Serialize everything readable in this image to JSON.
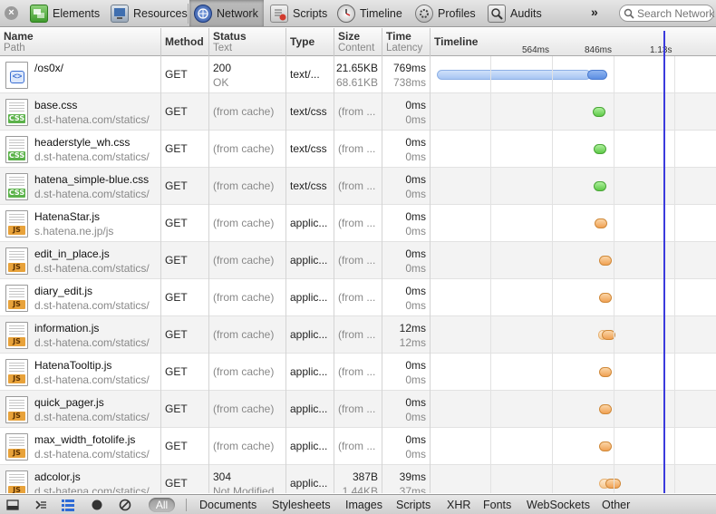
{
  "toolbar": {
    "close_glyph": "×",
    "tabs": [
      {
        "label": "Elements",
        "icon": "elements-icon",
        "active": false
      },
      {
        "label": "Resources",
        "icon": "resources-icon",
        "active": false
      },
      {
        "label": "Network",
        "icon": "network-icon",
        "active": true
      },
      {
        "label": "Scripts",
        "icon": "scripts-icon",
        "active": false
      },
      {
        "label": "Timeline",
        "icon": "timeline-icon",
        "active": false
      },
      {
        "label": "Profiles",
        "icon": "profiles-icon",
        "active": false
      },
      {
        "label": "Audits",
        "icon": "audits-icon",
        "active": false
      }
    ],
    "more_label": "»",
    "search_placeholder": "Search Network"
  },
  "columns": {
    "name": {
      "main": "Name",
      "sub": "Path"
    },
    "method": {
      "main": "Method"
    },
    "status": {
      "main": "Status",
      "sub": "Text"
    },
    "type": {
      "main": "Type"
    },
    "size": {
      "main": "Size",
      "sub": "Content"
    },
    "time": {
      "main": "Time",
      "sub": "Latency"
    },
    "timeline": {
      "main": "Timeline"
    }
  },
  "timeline_ticks": [
    "564ms",
    "846ms",
    "1.13s"
  ],
  "rows": [
    {
      "name": "/os0x/",
      "path": "",
      "kind": "doc",
      "method": "GET",
      "status": "200",
      "status_text": "OK",
      "type": "text/...",
      "size": "21.65KB",
      "content": "68.61KB",
      "time": "769ms",
      "latency": "738ms"
    },
    {
      "name": "base.css",
      "path": "d.st-hatena.com/statics/",
      "kind": "css",
      "method": "GET",
      "status": "(from cache)",
      "status_text": "",
      "type": "text/css",
      "size": "(from ...",
      "content": "",
      "time": "0ms",
      "latency": "0ms"
    },
    {
      "name": "headerstyle_wh.css",
      "path": "d.st-hatena.com/statics/",
      "kind": "css",
      "method": "GET",
      "status": "(from cache)",
      "status_text": "",
      "type": "text/css",
      "size": "(from ...",
      "content": "",
      "time": "0ms",
      "latency": "0ms"
    },
    {
      "name": "hatena_simple-blue.css",
      "path": "d.st-hatena.com/statics/",
      "kind": "css",
      "method": "GET",
      "status": "(from cache)",
      "status_text": "",
      "type": "text/css",
      "size": "(from ...",
      "content": "",
      "time": "0ms",
      "latency": "0ms"
    },
    {
      "name": "HatenaStar.js",
      "path": "s.hatena.ne.jp/js",
      "kind": "js",
      "method": "GET",
      "status": "(from cache)",
      "status_text": "",
      "type": "applic...",
      "size": "(from ...",
      "content": "",
      "time": "0ms",
      "latency": "0ms"
    },
    {
      "name": "edit_in_place.js",
      "path": "d.st-hatena.com/statics/",
      "kind": "js",
      "method": "GET",
      "status": "(from cache)",
      "status_text": "",
      "type": "applic...",
      "size": "(from ...",
      "content": "",
      "time": "0ms",
      "latency": "0ms"
    },
    {
      "name": "diary_edit.js",
      "path": "d.st-hatena.com/statics/",
      "kind": "js",
      "method": "GET",
      "status": "(from cache)",
      "status_text": "",
      "type": "applic...",
      "size": "(from ...",
      "content": "",
      "time": "0ms",
      "latency": "0ms"
    },
    {
      "name": "information.js",
      "path": "d.st-hatena.com/statics/",
      "kind": "js",
      "method": "GET",
      "status": "(from cache)",
      "status_text": "",
      "type": "applic...",
      "size": "(from ...",
      "content": "",
      "time": "12ms",
      "latency": "12ms"
    },
    {
      "name": "HatenaTooltip.js",
      "path": "d.st-hatena.com/statics/",
      "kind": "js",
      "method": "GET",
      "status": "(from cache)",
      "status_text": "",
      "type": "applic...",
      "size": "(from ...",
      "content": "",
      "time": "0ms",
      "latency": "0ms"
    },
    {
      "name": "quick_pager.js",
      "path": "d.st-hatena.com/statics/",
      "kind": "js",
      "method": "GET",
      "status": "(from cache)",
      "status_text": "",
      "type": "applic...",
      "size": "(from ...",
      "content": "",
      "time": "0ms",
      "latency": "0ms"
    },
    {
      "name": "max_width_fotolife.js",
      "path": "d.st-hatena.com/statics/",
      "kind": "js",
      "method": "GET",
      "status": "(from cache)",
      "status_text": "",
      "type": "applic...",
      "size": "(from ...",
      "content": "",
      "time": "0ms",
      "latency": "0ms"
    },
    {
      "name": "adcolor.js",
      "path": "d.st-hatena.com/statics/",
      "kind": "js",
      "method": "GET",
      "status": "304",
      "status_text": "Not Modified",
      "type": "applic...",
      "size": "387B",
      "content": "1.44KB",
      "time": "39ms",
      "latency": "37ms"
    }
  ],
  "statusbar": {
    "all_label": "All",
    "filters": [
      "Documents",
      "Stylesheets",
      "Images",
      "Scripts",
      "XHR",
      "Fonts",
      "WebSockets",
      "Other"
    ]
  },
  "colors": {
    "marker": "#3b3bdd",
    "css": "#5fc948",
    "js": "#f0a154",
    "doc": "#5d8fe3"
  }
}
